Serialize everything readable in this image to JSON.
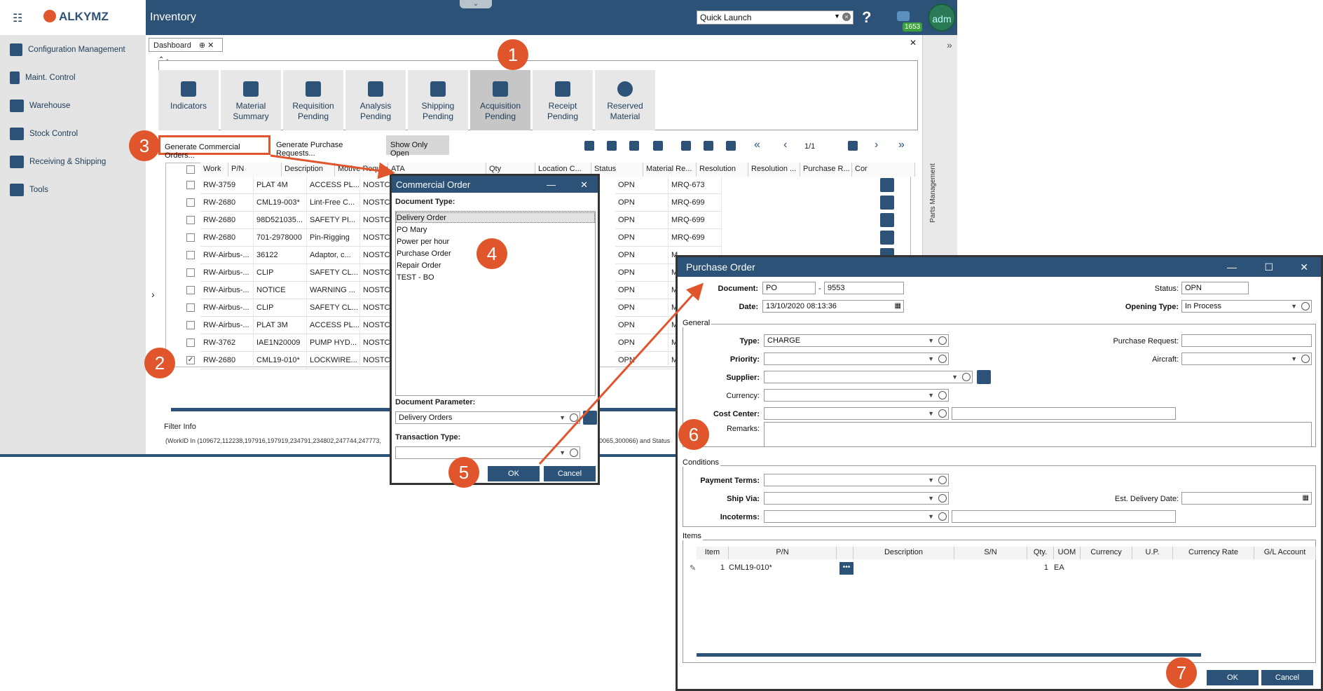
{
  "app": {
    "brand": "ALKYMZ",
    "module_title": "Inventory",
    "quick_launch": "Quick Launch",
    "help": "?",
    "notif_count": "1653",
    "avatar": "adm",
    "right_rail_label": "Parts Management"
  },
  "nav": [
    {
      "label": "Configuration Management",
      "icon": "config-icon"
    },
    {
      "label": "Maint. Control",
      "icon": "maint-icon"
    },
    {
      "label": "Warehouse",
      "icon": "warehouse-icon"
    },
    {
      "label": "Stock Control",
      "icon": "stock-icon"
    },
    {
      "label": "Receiving & Shipping",
      "icon": "truck-icon"
    },
    {
      "label": "Tools",
      "icon": "tools-icon"
    }
  ],
  "dashboard_tab": "Dashboard",
  "tiles": [
    {
      "l1": "Indicators",
      "l2": ""
    },
    {
      "l1": "Material",
      "l2": "Summary"
    },
    {
      "l1": "Requisition",
      "l2": "Pending"
    },
    {
      "l1": "Analysis",
      "l2": "Pending"
    },
    {
      "l1": "Shipping",
      "l2": "Pending"
    },
    {
      "l1": "Acquisition",
      "l2": "Pending"
    },
    {
      "l1": "Receipt",
      "l2": "Pending"
    },
    {
      "l1": "Reserved",
      "l2": "Material"
    }
  ],
  "toolbar": {
    "gen_commercial": "Generate Commercial Orders...",
    "gen_purchase": "Generate Purchase Requests...",
    "show_only_open": "Show Only Open",
    "page": "1/1"
  },
  "grid": {
    "headers": [
      "Work",
      "P/N",
      "Description",
      "Motive Request",
      "ATA",
      "Qty",
      "Location C...",
      "Status",
      "Material Re...",
      "Resolution",
      "Resolution ...",
      "Purchase R...",
      "Cor"
    ],
    "rows": [
      {
        "work": "RW-3759",
        "pn": "PLAT 4M",
        "desc": "ACCESS PL...",
        "motive": "NOSTCK",
        "status": "OPN",
        "mr": "MRQ-673",
        "checked": false
      },
      {
        "work": "RW-2680",
        "pn": "CML19-003*",
        "desc": "Lint-Free C...",
        "motive": "NOSTCK",
        "status": "OPN",
        "mr": "MRQ-699",
        "checked": false
      },
      {
        "work": "RW-2680",
        "pn": "98D521035...",
        "desc": "SAFETY PI...",
        "motive": "NOSTCK",
        "status": "OPN",
        "mr": "MRQ-699",
        "checked": false
      },
      {
        "work": "RW-2680",
        "pn": "701-2978000",
        "desc": "Pin-Rigging",
        "motive": "NOSTCK",
        "status": "OPN",
        "mr": "MRQ-699",
        "checked": false
      },
      {
        "work": "RW-Airbus-...",
        "pn": "36122",
        "desc": "Adaptor, c...",
        "motive": "NOSTCK",
        "status": "OPN",
        "mr": "M",
        "checked": false
      },
      {
        "work": "RW-Airbus-...",
        "pn": "CLIP",
        "desc": "SAFETY CL...",
        "motive": "NOSTCK",
        "status": "OPN",
        "mr": "M",
        "checked": false
      },
      {
        "work": "RW-Airbus-...",
        "pn": "NOTICE",
        "desc": "WARNING ...",
        "motive": "NOSTCK",
        "status": "OPN",
        "mr": "M",
        "checked": false
      },
      {
        "work": "RW-Airbus-...",
        "pn": "CLIP",
        "desc": "SAFETY CL...",
        "motive": "NOSTCK",
        "status": "OPN",
        "mr": "M",
        "checked": false
      },
      {
        "work": "RW-Airbus-...",
        "pn": "PLAT 3M",
        "desc": "ACCESS PL...",
        "motive": "NOSTCK",
        "status": "OPN",
        "mr": "M",
        "checked": false
      },
      {
        "work": "RW-3762",
        "pn": "IAE1N20009",
        "desc": "PUMP HYD...",
        "motive": "NOSTCK",
        "status": "OPN",
        "mr": "M",
        "checked": false
      },
      {
        "work": "RW-2680",
        "pn": "CML19-010*",
        "desc": "LOCKWIRE...",
        "motive": "NOSTCK",
        "status": "OPN",
        "mr": "M",
        "checked": true
      }
    ]
  },
  "filter": {
    "label": "Filter Info",
    "text": "(WorkID In (109672,112238,197916,197919,234791,234802,247744,247773,",
    "text_tail": "00065,300066) and Status"
  },
  "commercial_order": {
    "title": "Commercial Order",
    "doc_type_label": "Document Type:",
    "types": [
      "Delivery Order",
      "PO Mary",
      "Power per hour",
      "Purchase Order",
      "Repair Order",
      "TEST - BO"
    ],
    "doc_param_label": "Document Parameter:",
    "doc_param_value": "Delivery Orders",
    "trans_type_label": "Transaction Type:",
    "ok": "OK",
    "cancel": "Cancel"
  },
  "purchase_order": {
    "title": "Purchase Order",
    "document_label": "Document:",
    "doc_prefix": "PO",
    "doc_sep": "-",
    "doc_number": "9553",
    "date_label": "Date:",
    "date_value": "13/10/2020 08:13:36",
    "status_label": "Status:",
    "status_value": "OPN",
    "opening_label": "Opening Type:",
    "opening_value": "In Process",
    "general": "General",
    "type_label": "Type:",
    "type_value": "CHARGE",
    "priority_label": "Priority:",
    "supplier_label": "Supplier:",
    "currency_label": "Currency:",
    "cost_center_label": "Cost Center:",
    "remarks_label": "Remarks:",
    "purchase_request_label": "Purchase Request:",
    "aircraft_label": "Aircraft:",
    "conditions": "Conditions",
    "payment_label": "Payment Terms:",
    "shipvia_label": "Ship Via:",
    "incoterms_label": "Incoterms:",
    "est_delivery_label": "Est. Delivery Date:",
    "items": "Items",
    "item_headers": [
      "Item",
      "P/N",
      "",
      "Description",
      "S/N",
      "Qty.",
      "UOM",
      "Currency",
      "U.P.",
      "Currency Rate",
      "G/L Account"
    ],
    "item_row": {
      "item": "1",
      "pn": "CML19-010*",
      "qty": "1",
      "uom": "EA"
    },
    "ok": "OK",
    "cancel": "Cancel"
  },
  "markers": [
    "1",
    "2",
    "3",
    "4",
    "5",
    "6",
    "7"
  ],
  "colors": {
    "header": "#2c5277",
    "accent": "#e0552b",
    "nav_bg": "#e4e4e4"
  }
}
